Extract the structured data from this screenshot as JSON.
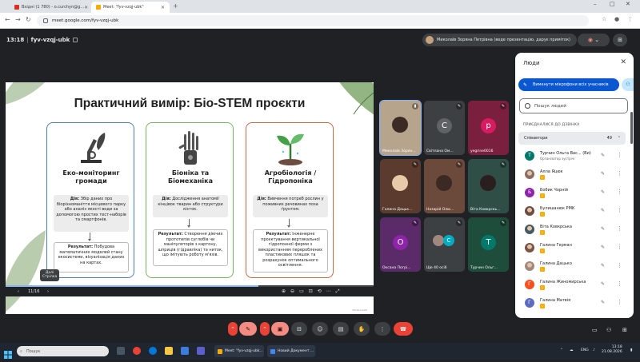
{
  "browser": {
    "tabs": [
      {
        "label": "Вхідні (1 780) - o.curchyn@g...",
        "fav_color": "#d93025",
        "active": false
      },
      {
        "label": "Meet: \"fyv-vzqj-ubk\"",
        "fav_color": "#f9ab00",
        "active": true
      }
    ],
    "new_tab": "+",
    "url": "meet.google.com/fyv-vzqj-ubk",
    "window_controls": [
      "–",
      "□",
      "✕"
    ]
  },
  "meeting": {
    "time": "13:18",
    "code": "fyv-vzqj-ubk",
    "presenter_label": "Миколаїв Зоряна Петрівна (веде презентацію, дарує приміток)"
  },
  "slide": {
    "title": "Практичний вимір: Біо-STEM проєкти",
    "cards": [
      {
        "title": "Еко-моніторинг громади",
        "action_label": "Дія:",
        "action_text": "Збір даних про біорізноманіття місцевого парку або аналіз якості води за допомогою простих тест-наборів та смартфонів.",
        "result_label": "Результат:",
        "result_text": "Побудова математичних моделей стану екосистеми, візуалізація даних на картах.",
        "color": "#4a80b7"
      },
      {
        "title": "Біоніка та Біомеханіка",
        "action_label": "Дія:",
        "action_text": "Дослідження анатомії кінцівок тварин або структури кісток.",
        "result_label": "Результат:",
        "result_text": "Створення діючих прототипів суглобів чи маніпуляторів з картону, шприців (гідравліка) та ниток, що імітують роботу м'язів.",
        "color": "#79b35f"
      },
      {
        "title": "Агробіологія / Гідропоніка",
        "action_label": "Дія:",
        "action_text": "Вивчення потреб рослин у поживних речовинах поза ґрунтом.",
        "result_label": "Результат:",
        "result_text": "Інженерне проєктування вертикальної гідропонної ферми з використанням перероблених пластикових пляшок та розрахунок оптимального освітлення.",
        "color": "#c96a45"
      }
    ],
    "credit": "NotebookLM",
    "page_indicator": "11/16",
    "progress": 0.6875,
    "tooltip": "Далі\nСтрілка"
  },
  "tiles": [
    {
      "name": "Миколаїв Зорян...",
      "kind": "video",
      "bg": "#b7a48d",
      "face": "#3a2b25",
      "speaking": true
    },
    {
      "name": "Світлана Ом...",
      "kind": "letter",
      "letter": "С",
      "bg": "#3c4043",
      "circle": "#5f6368"
    },
    {
      "name": "yegrine0016",
      "kind": "letter",
      "letter": "р",
      "bg": "#7b1f3f",
      "circle": "#d81b60"
    },
    {
      "name": "Галина Дацьк...",
      "kind": "video",
      "bg": "#5a3b2e",
      "face": "#e8c9a8"
    },
    {
      "name": "Назарій Олю...",
      "kind": "video",
      "bg": "#6b4a3b",
      "face": "#3b2a24"
    },
    {
      "name": "Віта Ковкрскь...",
      "kind": "video",
      "bg": "#2f4e45",
      "face": "#2a1e1e"
    },
    {
      "name": "Оксана Погрі...",
      "kind": "letter",
      "letter": "O",
      "bg": "#5b2a68",
      "circle": "#8e24aa"
    },
    {
      "name": "Ще 40 осіб",
      "kind": "more",
      "bg": "#3c4043"
    },
    {
      "name": "Турчин Ольг...",
      "kind": "letter",
      "letter": "T",
      "bg": "#1f4d3c",
      "circle": "#00796b"
    }
  ],
  "people_panel": {
    "title": "Люди",
    "mute_all": "Вимкнути мікрофони всіх учасників",
    "search_placeholder": "Пошук людей",
    "section": "ПРИЄДНАЛИСЯ ДО ДЗВІНКА",
    "collaborators_label": "Співавтори",
    "collaborators_count": "49",
    "people": [
      {
        "name": "Турчин Ольга Вас...  (Ви)",
        "sub": "Організатор зустрічі",
        "letter": "T",
        "color": "#00796b",
        "photo": false,
        "hand": false
      },
      {
        "name": "Алла Яцюк",
        "letter": "",
        "color": "#8d6e63",
        "photo": true,
        "hand": true
      },
      {
        "name": "Бобик Чорній",
        "letter": "Б",
        "color": "#8e24aa",
        "photo": false,
        "hand": true
      },
      {
        "name": "Булишанюк РМК",
        "letter": "",
        "color": "#6d4c41",
        "photo": true,
        "hand": true
      },
      {
        "name": "Віта Ковкрська",
        "letter": "",
        "color": "#455a64",
        "photo": true,
        "hand": true
      },
      {
        "name": "Галина Герман",
        "letter": "",
        "color": "#795548",
        "photo": true,
        "hand": true
      },
      {
        "name": "Галина Дацько",
        "letter": "",
        "color": "#a1887f",
        "photo": true,
        "hand": true
      },
      {
        "name": "Галина Жиномирська",
        "letter": "Г",
        "color": "#f4511e",
        "photo": false,
        "hand": true
      },
      {
        "name": "Галина Матвія",
        "letter": "Г",
        "color": "#5c6bc0",
        "photo": false,
        "hand": true
      }
    ]
  },
  "taskbar": {
    "search_placeholder": "Пошук",
    "tasks": [
      {
        "label": "Meet: \"fyv-vzqj-ubk...",
        "fav": "#f9ab00"
      },
      {
        "label": "Новий Документ ...",
        "fav": "#4285f4"
      }
    ],
    "lang": "ENG",
    "time": "13:18",
    "date": "21.08.2026"
  }
}
